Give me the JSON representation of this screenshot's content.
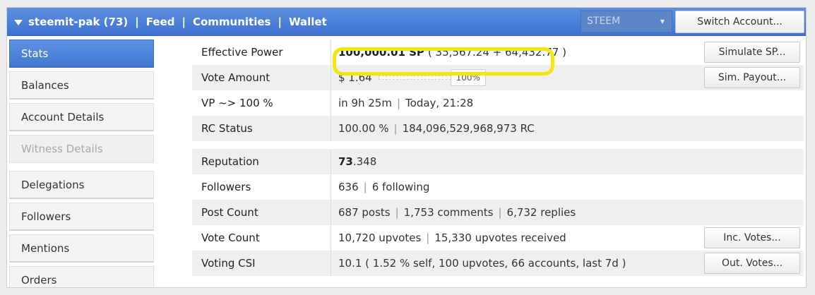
{
  "header": {
    "account": "steemit-pak (73)",
    "nav": [
      "Feed",
      "Communities",
      "Wallet"
    ],
    "currency_select": "STEEM",
    "switch_account_label": "Switch Account..."
  },
  "sidebar": {
    "items": [
      {
        "label": "Stats"
      },
      {
        "label": "Balances"
      },
      {
        "label": "Account Details"
      },
      {
        "label": "Witness Details"
      },
      {
        "label": "Delegations"
      },
      {
        "label": "Followers"
      },
      {
        "label": "Mentions"
      },
      {
        "label": "Orders"
      }
    ]
  },
  "stats": {
    "effective_power": {
      "label": "Effective Power",
      "value": "100,000.01 SP",
      "detail": "( 35,567.24 + 64,432.77 )",
      "button": "Simulate SP..."
    },
    "vote_amount": {
      "label": "Vote Amount",
      "value": "$ 1.64",
      "slider_percent": 100,
      "slider_label": "100%",
      "button": "Sim. Payout..."
    },
    "vp": {
      "label": "VP ~> 100 %",
      "in": "in 9h 25m",
      "at": "Today, 21:28"
    },
    "rc": {
      "label": "RC Status",
      "percent": "100.00 %",
      "amount": "184,096,529,968,973 RC"
    },
    "reputation": {
      "label": "Reputation",
      "value_int": "73",
      "value_dec": ".348"
    },
    "followers": {
      "label": "Followers",
      "count": "636",
      "following": "6 following"
    },
    "post_count": {
      "label": "Post Count",
      "posts": "687 posts",
      "comments": "1,753 comments",
      "replies": "6,732 replies"
    },
    "vote_count": {
      "label": "Vote Count",
      "upvotes": "10,720 upvotes",
      "received": "15,330 upvotes received",
      "button": "Inc. Votes..."
    },
    "voting_csi": {
      "label": "Voting CSI",
      "value": "10.1 ( 1.52 % self, 100 upvotes, 66 accounts, last 7d )",
      "button": "Out. Votes..."
    }
  },
  "colors": {
    "header_blue": "#4a7fd8",
    "highlight": "#f4e60a"
  }
}
